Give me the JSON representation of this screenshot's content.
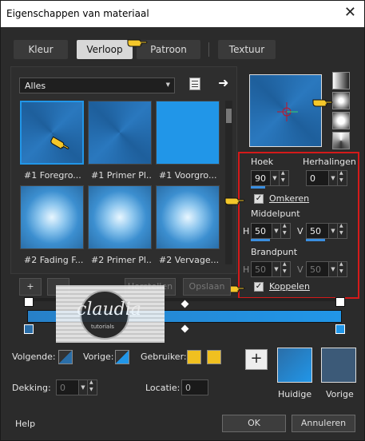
{
  "window": {
    "title": "Eigenschappen van materiaal",
    "close": "✕"
  },
  "tabs": [
    {
      "label": "Kleur"
    },
    {
      "label": "Verloop"
    },
    {
      "label": "Patroon"
    },
    {
      "label": "Textuur"
    }
  ],
  "filter": {
    "value": "Alles"
  },
  "gradients": [
    {
      "label": "#1 Foregro..."
    },
    {
      "label": "#1 Primer Pl..."
    },
    {
      "label": "#1 Voorgro..."
    },
    {
      "label": "#2 Fading F..."
    },
    {
      "label": "#2 Primer Pl..."
    },
    {
      "label": "#2 Vervage..."
    }
  ],
  "settings": {
    "hoek_label": "Hoek",
    "hoek_value": "90",
    "herhalingen_label": "Herhalingen",
    "herhalingen_value": "0",
    "omkeren_label": "Omkeren",
    "middelpunt_label": "Middelpunt",
    "middel_h_label": "H",
    "middel_h_value": "50",
    "middel_v_label": "V",
    "middel_v_value": "50",
    "brandpunt_label": "Brandpunt",
    "brand_h_label": "H",
    "brand_h_value": "50",
    "brand_v_label": "V",
    "brand_v_value": "50",
    "koppelen_label": "Koppelen"
  },
  "list_buttons": {
    "add": "+",
    "herstellen": "Herstellen",
    "opslaan": "Opslaan"
  },
  "watermark": {
    "text": "claudia",
    "sub": "tutorials"
  },
  "bottom": {
    "volgende_label": "Volgende:",
    "vorige_label": "Vorige:",
    "gebruiker_label": "Gebruiker:",
    "dekking_label": "Dekking:",
    "dekking_value": "0",
    "locatie_label": "Locatie:",
    "locatie_value": "0",
    "plus": "+",
    "huidige_label": "Huidige",
    "vorige_swatch_label": "Vorige"
  },
  "footer": {
    "help": "Help",
    "ok": "OK",
    "cancel": "Annuleren"
  },
  "colors": {
    "accent": "#2196e8",
    "highlight": "#e02020",
    "gold": "#f0c020"
  }
}
